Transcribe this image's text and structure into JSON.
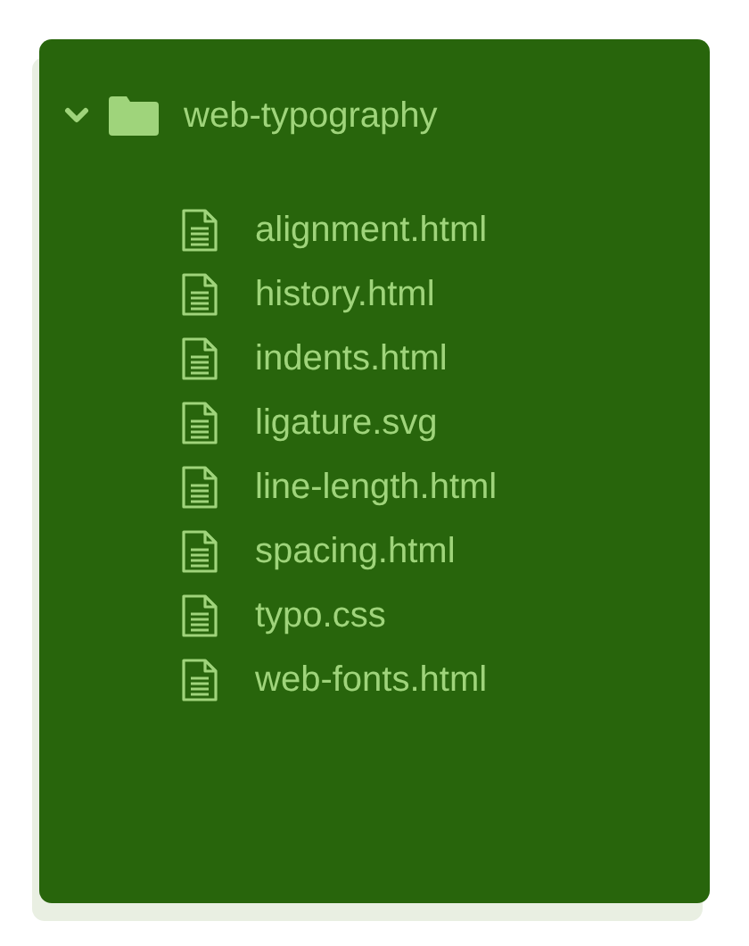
{
  "folder": {
    "name": "web-typography",
    "expanded": true,
    "children": [
      {
        "name": "alignment.html"
      },
      {
        "name": "history.html"
      },
      {
        "name": "indents.html"
      },
      {
        "name": "ligature.svg"
      },
      {
        "name": "line-length.html"
      },
      {
        "name": "spacing.html"
      },
      {
        "name": "typo.css"
      },
      {
        "name": "web-fonts.html"
      }
    ]
  }
}
